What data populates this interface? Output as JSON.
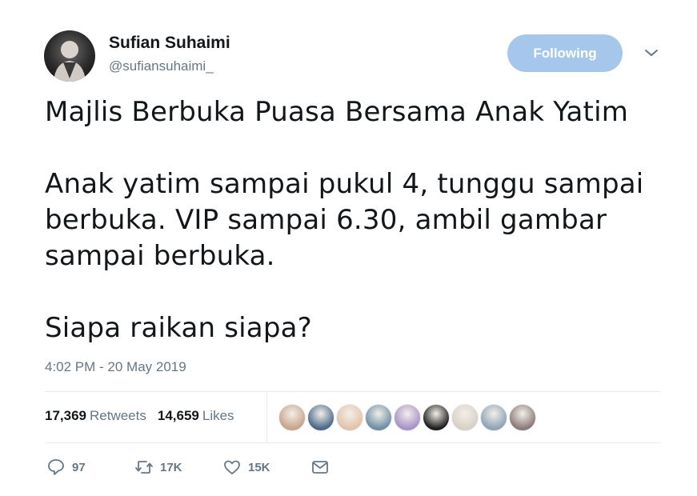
{
  "author": {
    "name": "Sufian Suhaimi",
    "handle": "@sufiansuhaimi_"
  },
  "follow_button": {
    "label": "Following"
  },
  "tweet": {
    "line1": "Majlis Berbuka Puasa Bersama Anak Yatim",
    "line2": "Anak yatim sampai pukul 4, tunggu sampai berbuka. VIP sampai 6.30, ambil gambar sampai berbuka.",
    "line3": "Siapa raikan siapa?"
  },
  "timestamp": "4:02 PM - 20 May 2019",
  "stats": {
    "retweets_count": "17,369",
    "retweets_label": "Retweets",
    "likes_count": "14,659",
    "likes_label": "Likes"
  },
  "liker_avatars": [
    {
      "icon": "avatar-1",
      "color": "#c9a48a"
    },
    {
      "icon": "avatar-2",
      "color": "#4a6a8a"
    },
    {
      "icon": "avatar-3",
      "color": "#e3c3a8"
    },
    {
      "icon": "avatar-4",
      "color": "#6f8fa6"
    },
    {
      "icon": "avatar-5",
      "color": "#a892c9"
    },
    {
      "icon": "avatar-6",
      "color": "#1f1f1f"
    },
    {
      "icon": "avatar-7",
      "color": "#d8d0c4"
    },
    {
      "icon": "avatar-8",
      "color": "#8fa3b5"
    },
    {
      "icon": "avatar-9",
      "color": "#8c7a78"
    }
  ],
  "actions": {
    "reply_count": "97",
    "retweet_count": "17K",
    "like_count": "15K"
  },
  "colors": {
    "accent": "#a5c7eb",
    "muted": "#657786",
    "text": "#14171a",
    "border": "#e6ecf0"
  }
}
